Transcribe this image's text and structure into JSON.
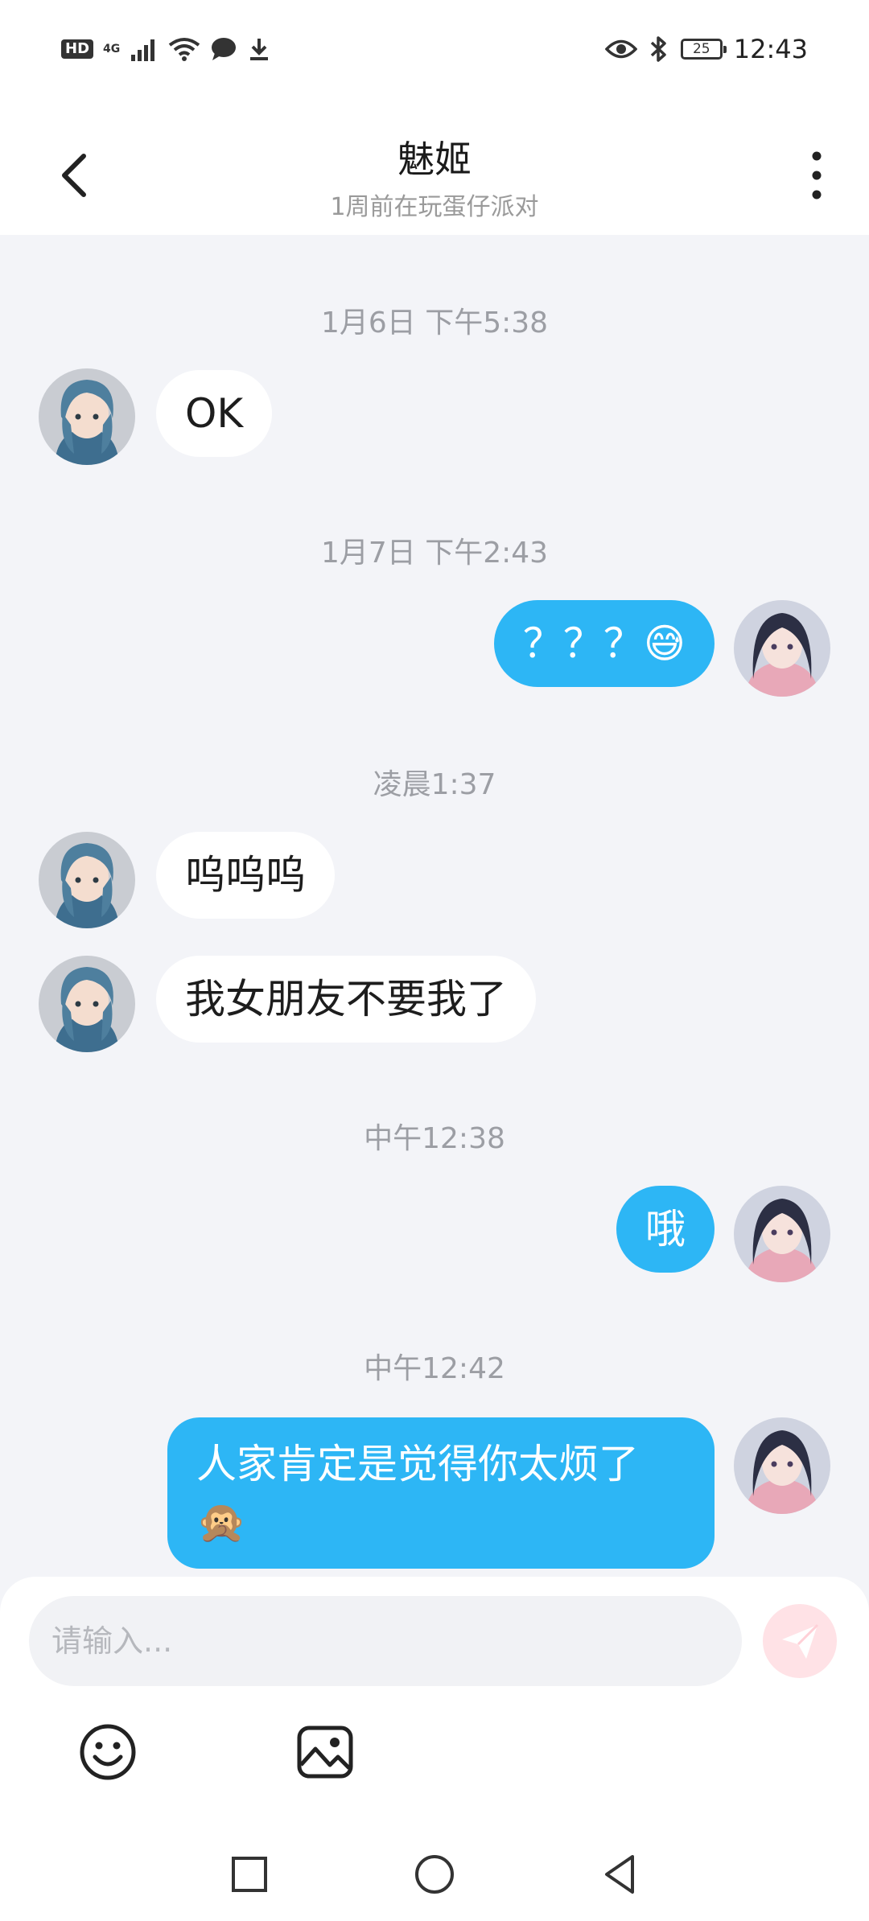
{
  "status_bar": {
    "hd": "HD",
    "network": "4G",
    "battery": "25",
    "time": "12:43"
  },
  "header": {
    "title": "魅姬",
    "subtitle": "1周前在玩蛋仔派对"
  },
  "conversation": {
    "timestamps": [
      "1月6日 下午5:38",
      "1月7日 下午2:43",
      "凌晨1:37",
      "中午12:38",
      "中午12:42"
    ],
    "messages": [
      {
        "side": "incoming",
        "text": "OK"
      },
      {
        "side": "outgoing",
        "text": "？？？😅"
      },
      {
        "side": "incoming",
        "text": "呜呜呜"
      },
      {
        "side": "incoming",
        "text": "我女朋友不要我了"
      },
      {
        "side": "outgoing",
        "text": "哦"
      },
      {
        "side": "outgoing",
        "text": "人家肯定是觉得你太烦了🙊"
      }
    ]
  },
  "composer": {
    "placeholder": "请输入..."
  },
  "icons": {
    "back": "chevron-left-icon",
    "more": "more-vertical-icon",
    "send": "paper-plane-icon",
    "emoji": "smiley-icon",
    "image": "image-icon",
    "nav_recent": "square-icon",
    "nav_home": "circle-icon",
    "nav_back": "triangle-back-icon"
  },
  "colors": {
    "outgoing_bubble": "#2db6f5",
    "incoming_bubble": "#ffffff",
    "background": "#f3f4f8",
    "send_button": "#ffe2e6"
  }
}
